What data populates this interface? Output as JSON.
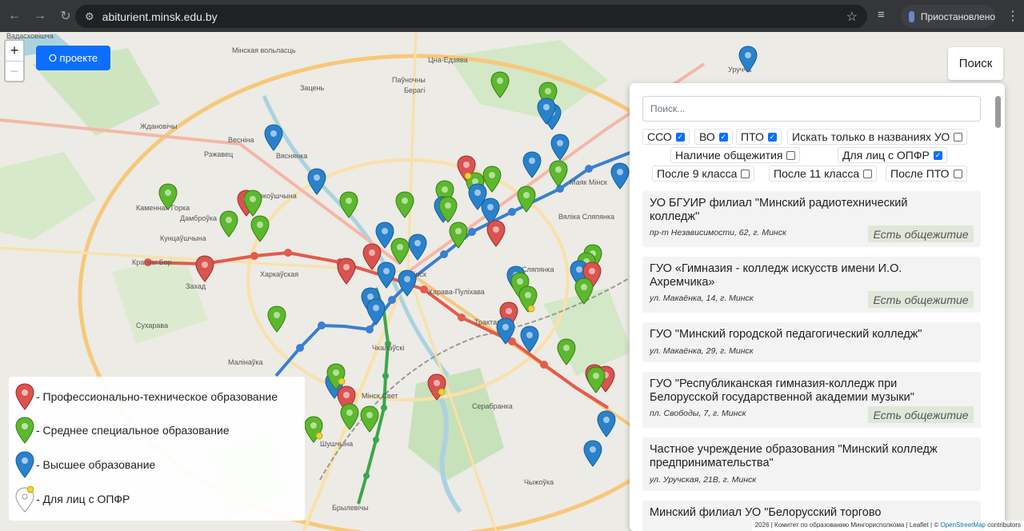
{
  "browser": {
    "url": "abiturient.minsk.edu.by",
    "profile_status": "Приостановлено"
  },
  "map": {
    "zoom_in": "+",
    "zoom_out": "−",
    "about_button": "О проекте",
    "search_button": "Поиск",
    "labels": [
      "Вадасховішча",
      "Мінская вольласць",
      "Цна-Едзява",
      "Зацень",
      "Паўночны",
      "Берагі",
      "Ждановічы",
      "Весніна",
      "Рэжавец",
      "Вяснянка",
      "Масюкоўшчына",
      "Каменная Горка",
      "Дамброўка",
      "Кунцаўшчына",
      "Красны Бор",
      "Захад",
      "Харкаўская",
      "Сухарава",
      "Малінаўка",
      "Вяліка Сляпянка",
      "Сляпянка",
      "Мінск",
      "Харава-Пуліхава",
      "Чкалаўскі",
      "Мінск Свет",
      "Серабранка",
      "Чыжоўка",
      "Шушчына",
      "Трактарны",
      "Уручча",
      "Маяк Мінск",
      "Брылевічы",
      "Серабранка"
    ],
    "attribution": "2026 | Комитет по образованию Мингорисполкома | Leaflet | © ",
    "attribution_link": "OpenStreetMap",
    "attribution_tail": " contributors"
  },
  "legend": [
    {
      "label": "- Профессионально-техническое образование",
      "color": "#d9534f"
    },
    {
      "label": "- Среднее специальное образование",
      "color": "#5cb82c"
    },
    {
      "label": "- Высшее образование",
      "color": "#2a81cb"
    },
    {
      "label": "- Для лиц с ОПФР",
      "color": "#f2d22e"
    }
  ],
  "panel": {
    "search_placeholder": "Поиск...",
    "filters": [
      {
        "label": "ССО",
        "checked": true
      },
      {
        "label": "ВО",
        "checked": true
      },
      {
        "label": "ПТО",
        "checked": true
      },
      {
        "label": "Искать только в названиях УО",
        "checked": false
      },
      {
        "label": "Наличие общежития",
        "checked": false
      },
      {
        "label": "Для лиц с ОПФР",
        "checked": true
      },
      {
        "label": "После 9 класса",
        "checked": false
      },
      {
        "label": "После 11 класса",
        "checked": false
      },
      {
        "label": "После ПТО",
        "checked": false
      }
    ],
    "results": [
      {
        "name": "УО БГУИР филиал \"Минский радиотехнический колледж\"",
        "address": "пр-т Независимости, 62, г. Минск",
        "badge": "Есть общежитие"
      },
      {
        "name": "ГУО «Гимназия - колледж искусств имени И.О. Ахремчика»",
        "address": "ул. Макаёнка, 14, г. Минск",
        "badge": "Есть общежитие"
      },
      {
        "name": "ГУО \"Минский городской педагогический колледж\"",
        "address": "ул. Макаёнка, 29, г. Минск",
        "badge": ""
      },
      {
        "name": "ГУО \"Республиканская гимназия-колледж при Белорусской государственной академии музыки\"",
        "address": "пл. Свободы, 7, г. Минск",
        "badge": "Есть общежитие"
      },
      {
        "name": "Частное учреждение образования \"Минский колледж предпринимательства\"",
        "address": "ул. Уручская, 21В, г. Минск",
        "badge": ""
      },
      {
        "name": "Минский филиал УО \"Белорусский торгово",
        "address": "",
        "badge": ""
      }
    ]
  }
}
